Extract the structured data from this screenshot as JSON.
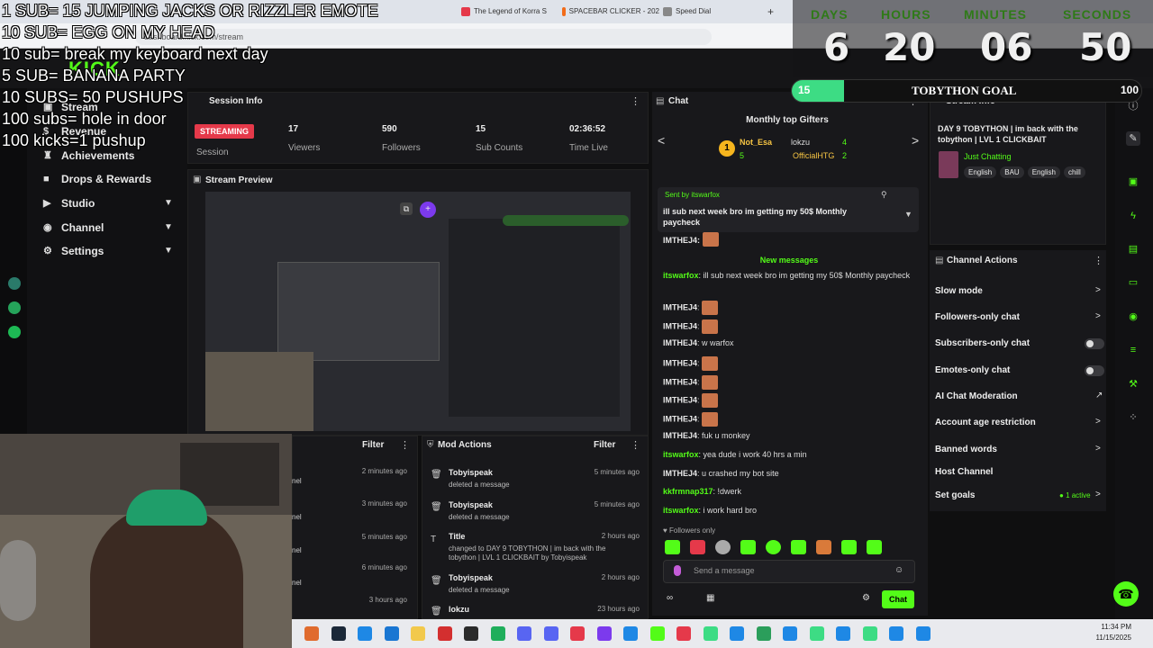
{
  "browser": {
    "tabs": [
      "The Legend of Korra S",
      "SPACEBAR CLICKER - 202",
      "Speed Dial"
    ],
    "url": "dashboard.kick.com/stream"
  },
  "overlay": {
    "lines": [
      "1 SUB= 15 JUMPING JACKS OR RIZZLER EMOTE",
      "10 SUB= EGG ON MY HEAD",
      "10 sub= break my keyboard next day",
      "5 SUB= BANANA  PARTY",
      "10 SUBS= 50 PUSHUPS",
      "100 subs= hole in door",
      "100 kicks=1 pushup"
    ]
  },
  "countdown": {
    "labels": [
      "DAYS",
      "HOURS",
      "MINUTES",
      "SECONDS"
    ],
    "values": [
      "6",
      "20",
      "06",
      "50"
    ]
  },
  "goal": {
    "current": "15",
    "title": "TOBYTHON GOAL",
    "target": "100",
    "progress": 0.15
  },
  "nav": {
    "items": [
      "Stream",
      "Revenue",
      "Achievements",
      "Drops & Rewards",
      "Studio",
      "Channel",
      "Settings"
    ]
  },
  "session": {
    "title": "Session Info",
    "status": "STREAMING",
    "session_label": "Session",
    "stats": [
      {
        "value": "17",
        "label": "Viewers"
      },
      {
        "value": "590",
        "label": "Followers"
      },
      {
        "value": "15",
        "label": "Sub Counts"
      },
      {
        "value": "02:36:52",
        "label": "Time Live"
      }
    ]
  },
  "preview": {
    "title": "Stream Preview"
  },
  "filters": {
    "filter_label": "Filter",
    "mod_actions_title": "Mod Actions"
  },
  "mod_actions": [
    {
      "user": "Tobyispeak",
      "action": "deleted a message",
      "time": "5 minutes ago"
    },
    {
      "user": "Tobyispeak",
      "action": "deleted a message",
      "time": "5 minutes ago"
    },
    {
      "user": "Title",
      "action": "changed to DAY 9 TOBYTHON | im back with the tobython | LVL 1 CLICKBAIT by Tobyispeak",
      "time": "2 hours ago"
    },
    {
      "user": "Tobyispeak",
      "action": "deleted a message",
      "time": "2 hours ago"
    },
    {
      "user": "lokzu",
      "action": "",
      "time": "23 hours ago"
    }
  ],
  "left_times": [
    "2 minutes ago",
    "3 minutes ago",
    "5 minutes ago",
    "6 minutes ago",
    "3 hours ago"
  ],
  "chat": {
    "title": "Chat",
    "gifters_title": "Monthly top Gifters",
    "gifters": [
      {
        "name": "Not_Esa",
        "count": "5"
      },
      {
        "name": "lokzu",
        "count": "4"
      },
      {
        "name": "OfficialHTG",
        "count": "2"
      }
    ],
    "pinned_by": "Sent by itswarfox",
    "pinned_msg": "ill sub next week bro im getting my 50$ Monthly paycheck",
    "new_messages": "New messages",
    "messages": [
      {
        "user": "itswarfox",
        "text": "ill sub next week bro im getting my 50$ Monthly paycheck"
      },
      {
        "user": "IMTHEJ4",
        "text": ""
      },
      {
        "user": "IMTHEJ4",
        "text": ""
      },
      {
        "user": "IMTHEJ4",
        "text": "w warfox"
      },
      {
        "user": "IMTHEJ4",
        "text": ""
      },
      {
        "user": "IMTHEJ4",
        "text": ""
      },
      {
        "user": "IMTHEJ4",
        "text": ""
      },
      {
        "user": "IMTHEJ4",
        "text": ""
      },
      {
        "user": "IMTHEJ4",
        "text": "fuk u monkey"
      },
      {
        "user": "itswarfox",
        "text": "yea dude i work 40 hrs a min"
      },
      {
        "user": "IMTHEJ4",
        "text": "u crashed my bot site"
      },
      {
        "user": "kkfrmnap317",
        "text": "!dwerk"
      },
      {
        "user": "itswarfox",
        "text": "i work hard bro"
      }
    ],
    "followers_only": "Followers only",
    "placeholder": "Send a message",
    "send_label": "Chat"
  },
  "stream_info": {
    "title": "Stream Info",
    "stream_title": "DAY 9 TOBYTHON | im back with the tobython | LVL 1 CLICKBAIT",
    "category": "Just Chatting",
    "tags": [
      "English",
      "BAU",
      "English",
      "chill"
    ]
  },
  "channel_actions": {
    "title": "Channel Actions",
    "items": [
      {
        "label": "Slow mode",
        "control": "chevron"
      },
      {
        "label": "Followers-only chat",
        "control": "chevron"
      },
      {
        "label": "Subscribers-only chat",
        "control": "toggle"
      },
      {
        "label": "Emotes-only chat",
        "control": "toggle"
      },
      {
        "label": "AI Chat Moderation",
        "control": "external"
      },
      {
        "label": "Account age restriction",
        "control": "chevron"
      },
      {
        "label": "Banned words",
        "control": "chevron"
      },
      {
        "label": "Host Channel",
        "control": "none"
      },
      {
        "label": "Set goals",
        "control": "chevron"
      }
    ],
    "active_note": "1 active"
  },
  "taskbar": {
    "time": "11:34 PM",
    "date": "11/15/2025"
  },
  "colors": {
    "accent": "#53fc18",
    "streaming": "#e5394a",
    "goal": "#3ddc84"
  }
}
